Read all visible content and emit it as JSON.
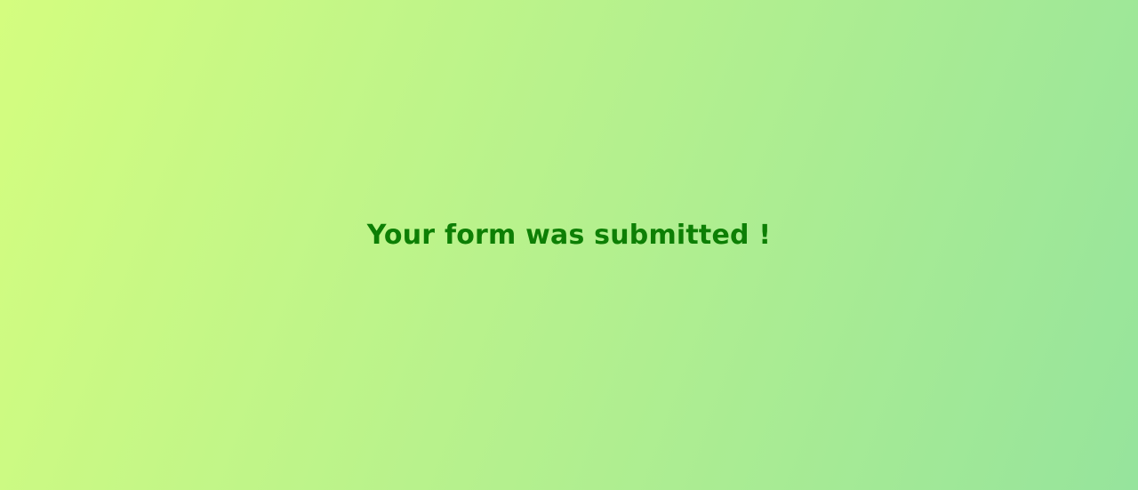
{
  "confirmation": {
    "message": "Your form was submitted !",
    "text_color": "#0d7f05"
  },
  "background": {
    "gradient_start": "#d4fd7f",
    "gradient_end": "#96e49c"
  }
}
